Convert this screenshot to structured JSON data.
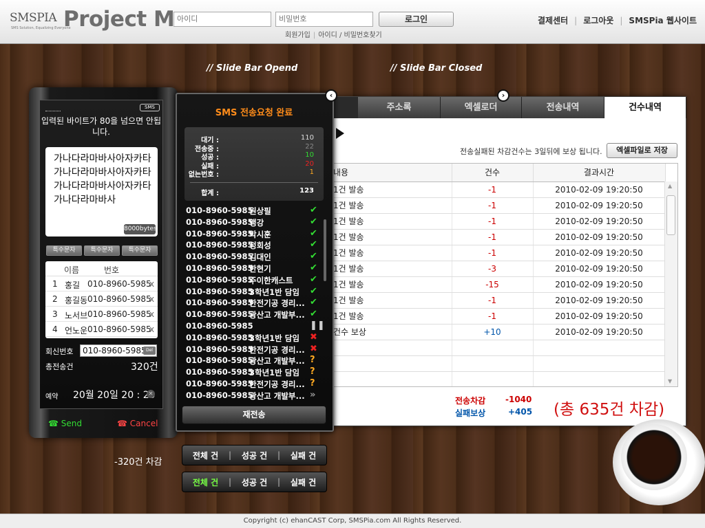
{
  "header": {
    "logo_text": "SMSPIA",
    "logo_sub": "SMS Solution, Equalizing Everyone",
    "title": "Project M",
    "id_placeholder": "아이디",
    "pw_placeholder": "비밀번호",
    "login_label": "로그인",
    "join_label": "회원가입",
    "find_label": "아이디 / 비밀번호찾기",
    "nav": [
      "결제센터",
      "로그아웃",
      "SMSPia 웹사이트"
    ]
  },
  "notes": {
    "slide_open": "// Slide Bar Opend",
    "slide_closed": "// Slide Bar Closed"
  },
  "tabs": [
    {
      "label": "주소록",
      "active": false
    },
    {
      "label": "엑셀로더",
      "active": false
    },
    {
      "label": "전송내역",
      "active": false
    },
    {
      "label": "건수내역",
      "active": true
    }
  ],
  "history": {
    "notice": "전송실패된 차감건수는 3일뒤에 보상 됩니다.",
    "excel_save_label": "엑셀파일로 저장",
    "columns": [
      "내용",
      "건수",
      "결과시간"
    ],
    "rows": [
      {
        "content": "1건 발송",
        "count": "-1",
        "time": "2010-02-09 19:20:50"
      },
      {
        "content": "1건 발송",
        "count": "-1",
        "time": "2010-02-09 19:20:50"
      },
      {
        "content": "1건 발송",
        "count": "-1",
        "time": "2010-02-09 19:20:50"
      },
      {
        "content": "1건 발송",
        "count": "-1",
        "time": "2010-02-09 19:20:50"
      },
      {
        "content": "1건 발송",
        "count": "-1",
        "time": "2010-02-09 19:20:50"
      },
      {
        "content": "1건 발송",
        "count": "-3",
        "time": "2010-02-09 19:20:50"
      },
      {
        "content": "1건 발송",
        "count": "-15",
        "time": "2010-02-09 19:20:50"
      },
      {
        "content": "1건 발송",
        "count": "-1",
        "time": "2010-02-09 19:20:50"
      },
      {
        "content": "1건 발송",
        "count": "-1",
        "time": "2010-02-09 19:20:50"
      },
      {
        "content": "건수 보상",
        "count": "+10",
        "time": "2010-02-09 19:20:50"
      }
    ],
    "empty_rows": 3,
    "sum_deduct_label": "전송차감",
    "sum_deduct_value": "-1040",
    "sum_comp_label": "실패보상",
    "sum_comp_value": "+405",
    "total_text": "(총 635건 차감)"
  },
  "phone": {
    "sms_badge": "SMS",
    "warning": "입력된 바이트가 80을 넘으면 안됩니다.",
    "message": "가나다라마바사아자카타가나다라마바사아자카타가나다라마바사아자카타가나다라마바사",
    "byte_badge": "8000bytes",
    "special_buttons": [
      "특수문자",
      "특수문자",
      "특수문자"
    ],
    "rec_head_name": "이름",
    "rec_head_number": "번호",
    "recipients": [
      {
        "idx": "1",
        "name": "홍길",
        "number": "010-8960-5985"
      },
      {
        "idx": "2",
        "name": "홍길동",
        "number": "010-8960-5985"
      },
      {
        "idx": "3",
        "name": "노서브",
        "number": "010-8960-5985"
      },
      {
        "idx": "4",
        "name": "언노운",
        "number": "010-8960-5985"
      }
    ],
    "remove_icon": "x",
    "callback_label": "회신번호",
    "callback_number": "010-8960-5985",
    "callback_clear": "Del",
    "total_label": "총전송건",
    "total_value": "320건",
    "reserve_label": "예약",
    "reserve_value": "20월 20일 20 : 20",
    "reserve_clear": "✕",
    "send_label": "Send",
    "cancel_label": "Cancel"
  },
  "result": {
    "title": "SMS 전송요청 완료",
    "stats": [
      {
        "label": "대기 :",
        "value": "110",
        "color": "#dddddd"
      },
      {
        "label": "전송중 :",
        "value": "22",
        "color": "#888888"
      },
      {
        "label": "성공 :",
        "value": "10",
        "color": "#33dd33"
      },
      {
        "label": "실패 :",
        "value": "20",
        "color": "#ee2222"
      },
      {
        "label": "없는번호 :",
        "value": "1",
        "color": "#ffaa22"
      }
    ],
    "sum_label": "합계 :",
    "sum_value": "123",
    "rows": [
      {
        "phone": "010-8960-5985",
        "name": "원상필",
        "status": "success"
      },
      {
        "phone": "010-8960-5985",
        "name": "맹강",
        "status": "success"
      },
      {
        "phone": "010-8960-5985",
        "name": "박시훈",
        "status": "success"
      },
      {
        "phone": "010-8960-5985",
        "name": "정회성",
        "status": "success"
      },
      {
        "phone": "010-8960-5985",
        "name": "김대인",
        "status": "success"
      },
      {
        "phone": "010-8960-5985",
        "name": "한현기",
        "status": "success"
      },
      {
        "phone": "010-8960-5985",
        "name": "주이한캐스트",
        "status": "success"
      },
      {
        "phone": "010-8960-5985",
        "name": "3학년1반 담임",
        "status": "success"
      },
      {
        "phone": "010-8960-5985",
        "name": "한전기공 경리...",
        "status": "success"
      },
      {
        "phone": "010-8960-5985",
        "name": "광산고 개발부...",
        "status": "success"
      },
      {
        "phone": "010-8960-5985",
        "name": "",
        "status": "pending"
      },
      {
        "phone": "010-8960-5985",
        "name": "3학년1반 담임",
        "status": "fail"
      },
      {
        "phone": "010-8960-5985",
        "name": "한전기공 경리...",
        "status": "fail"
      },
      {
        "phone": "010-8960-5985",
        "name": "광산고 개발부...",
        "status": "unknown"
      },
      {
        "phone": "010-8960-5985",
        "name": "3학년1반 담임",
        "status": "unknown"
      },
      {
        "phone": "010-8960-5985",
        "name": "한전기공 경리...",
        "status": "unknown"
      },
      {
        "phone": "010-8960-5985",
        "name": "광산고 개발부...",
        "status": "more"
      }
    ],
    "status_icons": {
      "success": {
        "glyph": "✔",
        "color": "#33dd33",
        "icon": "check-icon"
      },
      "pending": {
        "glyph": "❚❚",
        "color": "#cccccc",
        "icon": "pause-icon"
      },
      "fail": {
        "glyph": "✖",
        "color": "#ee2222",
        "icon": "cross-icon"
      },
      "unknown": {
        "glyph": "?",
        "color": "#ffaa22",
        "icon": "question-icon"
      },
      "more": {
        "glyph": "»",
        "color": "#999999",
        "icon": "double-chevron-icon"
      }
    },
    "resend_label": "재전송"
  },
  "filters": {
    "labels": [
      "전체 건",
      "성공 건",
      "실패 건"
    ],
    "bar2_active_color": "#77ff44"
  },
  "deduct_note": "-320건 차감",
  "footer": "Copyright (c) ehanCAST Corp, SMSPia.com All Rights Reserved."
}
